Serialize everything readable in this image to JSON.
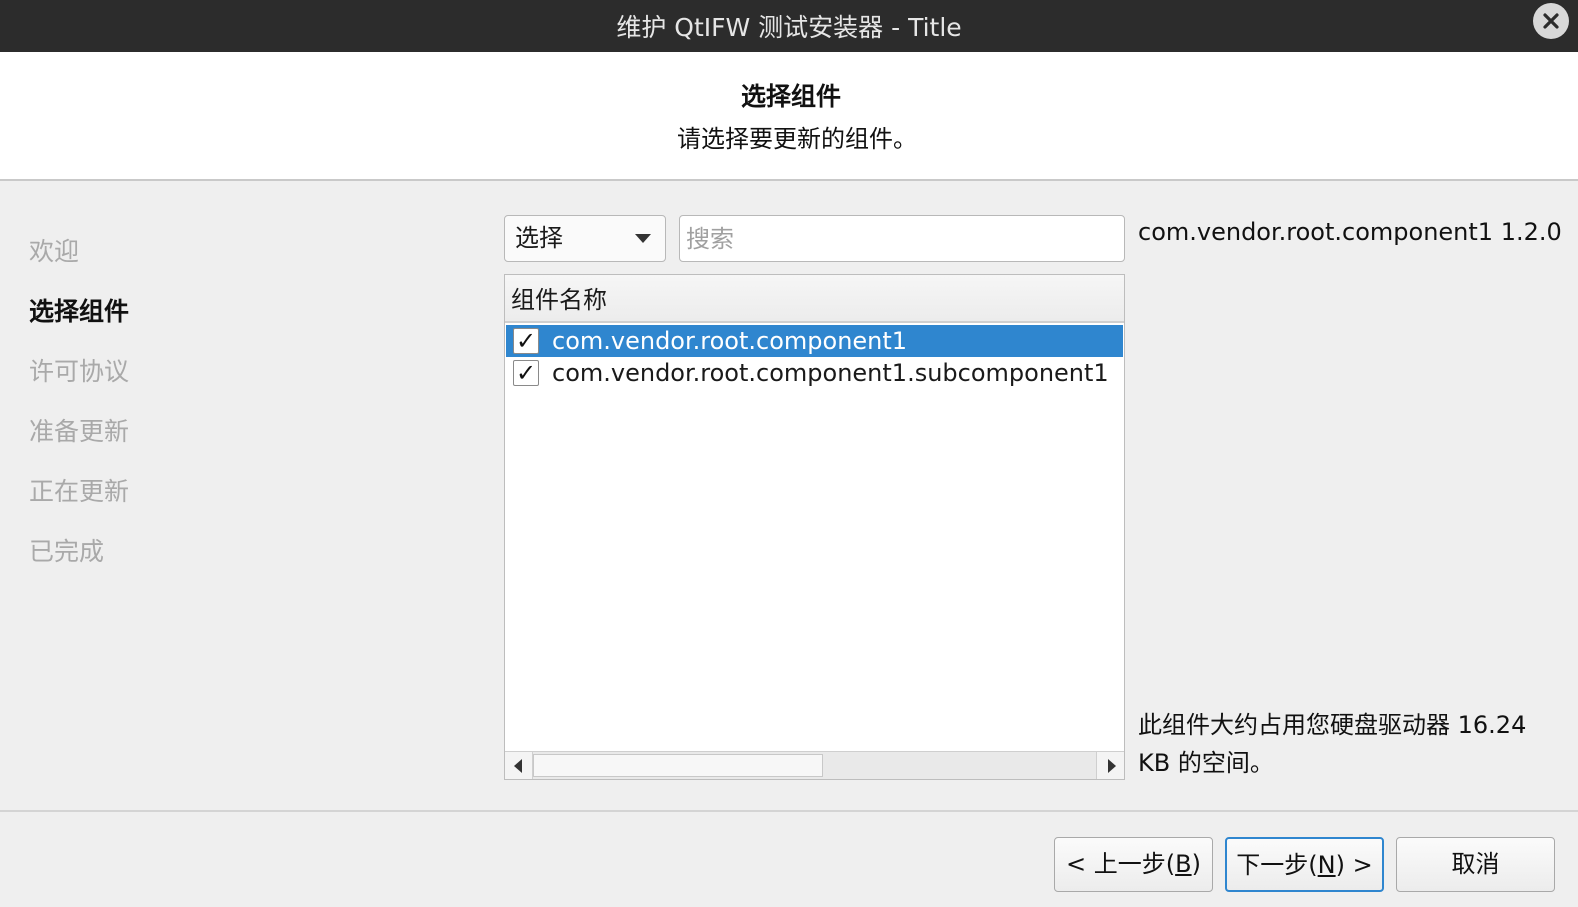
{
  "window": {
    "title": "维护 QtIFW 测试安装器 - Title",
    "close_icon": "close-icon"
  },
  "header": {
    "title": "选择组件",
    "subtitle": "请选择要更新的组件。"
  },
  "steps": [
    {
      "label": "欢迎",
      "active": false
    },
    {
      "label": "选择组件",
      "active": true
    },
    {
      "label": "许可协议",
      "active": false
    },
    {
      "label": "准备更新",
      "active": false
    },
    {
      "label": "正在更新",
      "active": false
    },
    {
      "label": "已完成",
      "active": false
    }
  ],
  "toolbar": {
    "select_value": "选择",
    "search_placeholder": "搜索",
    "search_value": ""
  },
  "tree": {
    "column_header": "组件名称",
    "rows": [
      {
        "label": "com.vendor.root.component1",
        "checked": true,
        "selected": true
      },
      {
        "label": "com.vendor.root.component1.subcomponent1",
        "checked": true,
        "selected": false
      }
    ]
  },
  "info": {
    "component_title": "com.vendor.root.component1 1.2.0",
    "size_text": "此组件大约占用您硬盘驱动器 16.24 KB 的空间。"
  },
  "buttons": {
    "back_pre": "< 上一步(",
    "back_key": "B",
    "back_post": ")",
    "next_pre": "下一步(",
    "next_key": "N",
    "next_post": ") >",
    "cancel": "取消"
  },
  "colors": {
    "titlebar_bg": "#2c2c2c",
    "selection": "#2f86cf",
    "inactive_step": "#a9a9a9"
  }
}
